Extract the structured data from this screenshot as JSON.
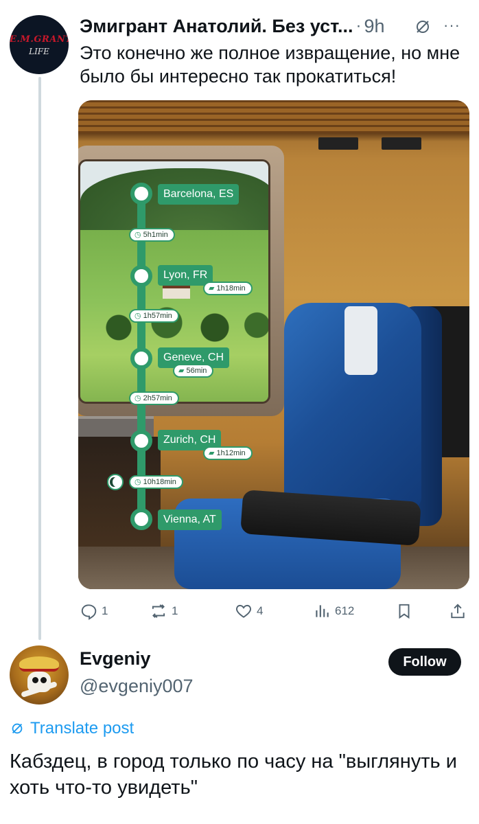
{
  "post": {
    "author_name": "Эмигрант Анатолий. Без уст...",
    "time": "9h",
    "text": "Это конечно же полное извращение, но мне было бы интересно так прокатиться!",
    "avatar_icon": "emigrants-life-logo",
    "media": {
      "route": [
        {
          "city": "Barcelona, ES"
        },
        {
          "duration": "5h1min"
        },
        {
          "city": "Lyon, FR",
          "stop_duration": "1h18min"
        },
        {
          "duration": "1h57min"
        },
        {
          "city": "Geneve, CH",
          "stop_duration": "56min"
        },
        {
          "duration": "2h57min"
        },
        {
          "city": "Zurich, CH",
          "stop_duration": "1h12min"
        },
        {
          "duration": "10h18min"
        },
        {
          "city": "Vienna, AT"
        }
      ],
      "route_color": "#2f9a6a"
    },
    "actions": {
      "replies": "1",
      "reposts": "1",
      "likes": "4",
      "views": "612"
    }
  },
  "reply": {
    "name": "Evgeniy",
    "handle": "@evgeniy007",
    "follow_label": "Follow",
    "translate_label": "Translate post",
    "text": "Кабздец, в город только по часу на \"выглянуть и хоть что-то увидеть\""
  },
  "colors": {
    "text_primary": "#0f1419",
    "text_secondary": "#536471",
    "link": "#1d9bf0",
    "thread_line": "#cfd9de"
  }
}
